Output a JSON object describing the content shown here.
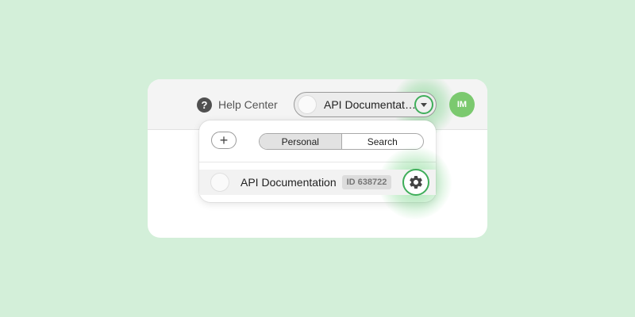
{
  "header": {
    "help_label": "Help Center",
    "help_icon": "question-circle-icon",
    "selector_label": "API Documentati…",
    "user_initials": "IM"
  },
  "dropdown": {
    "add_symbol": "+",
    "tabs": [
      {
        "label": "Personal",
        "active": true
      },
      {
        "label": "Search",
        "active": false
      }
    ],
    "items": [
      {
        "label": "API Documentation",
        "id_badge": "ID 638722",
        "settings_icon": "gear-icon"
      }
    ]
  },
  "colors": {
    "background": "#d3efd9",
    "accent": "#3fae5a",
    "avatar": "#7bc96f"
  }
}
